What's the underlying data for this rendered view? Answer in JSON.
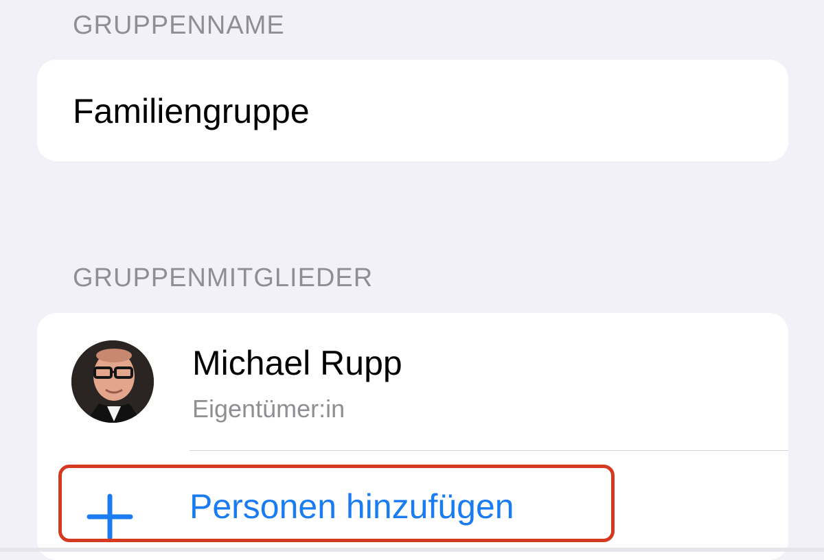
{
  "sections": {
    "group_name_header": "GRUPPENNAME",
    "group_members_header": "GRUPPENMITGLIEDER"
  },
  "group": {
    "name": "Familiengruppe"
  },
  "members": [
    {
      "name": "Michael Rupp",
      "role": "Eigentümer:in"
    }
  ],
  "actions": {
    "add_people_label": "Personen hinzufügen",
    "add_people_icon": "plus-icon"
  },
  "colors": {
    "background": "#f2f1f7",
    "card": "#ffffff",
    "accent": "#1a7cf0",
    "secondary_text": "#8e8e93",
    "highlight": "#d33a20"
  }
}
